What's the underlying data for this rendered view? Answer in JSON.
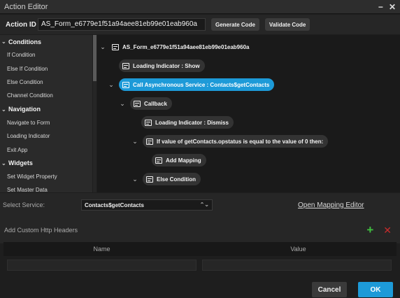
{
  "window": {
    "title": "Action Editor",
    "minimize_glyph": "−",
    "close_glyph": "✕"
  },
  "idbar": {
    "label": "Action ID",
    "value": "AS_Form_e6779e1f51a94aee81eb99e01eab960a",
    "generate_label": "Generate Code",
    "validate_label": "Validate Code"
  },
  "sidebar": {
    "sections": [
      {
        "label": "Conditions",
        "items": [
          "If Condition",
          "Else If Condition",
          "Else Condition",
          "Channel Condition"
        ]
      },
      {
        "label": "Navigation",
        "items": [
          "Navigate to Form",
          "Loading Indicator",
          "Exit App"
        ]
      },
      {
        "label": "Widgets",
        "items": [
          "Set Widget Property",
          "Set Master Data"
        ]
      }
    ]
  },
  "tree": {
    "nodes": [
      {
        "label": "AS_Form_e6779e1f51a94aee81eb99e01eab960a",
        "toggle": "⌄",
        "style": "plain"
      },
      {
        "label": "Loading Indicator : Show",
        "toggle": "",
        "style": "pill"
      },
      {
        "label": "Call Asynchronous Service : Contacts$getContacts",
        "toggle": "⌄",
        "style": "selected"
      },
      {
        "label": "Callback",
        "toggle": "⌄",
        "style": "pill"
      },
      {
        "label": "Loading Indicator : Dismiss",
        "toggle": "",
        "style": "pill"
      },
      {
        "label": "If value of getContacts.opstatus is equal to the value of 0 then:",
        "toggle": "⌄",
        "style": "pill"
      },
      {
        "label": "Add Mapping",
        "toggle": "",
        "style": "pill"
      },
      {
        "label": "Else Condition",
        "toggle": "⌄",
        "style": "pill"
      }
    ]
  },
  "service": {
    "label": "Select Service:",
    "value": "Contacts$getContacts",
    "mapping_link": "Open Mapping Editor"
  },
  "headers": {
    "label": "Add Custom Http Headers",
    "add_glyph": "+",
    "delete_glyph": "✕",
    "columns": [
      "Name",
      "Value"
    ]
  },
  "footer": {
    "cancel_label": "Cancel",
    "ok_label": "OK"
  },
  "colors": {
    "accent": "#1d9ad8",
    "add": "#3fbf3f",
    "delete": "#c62c2c"
  }
}
